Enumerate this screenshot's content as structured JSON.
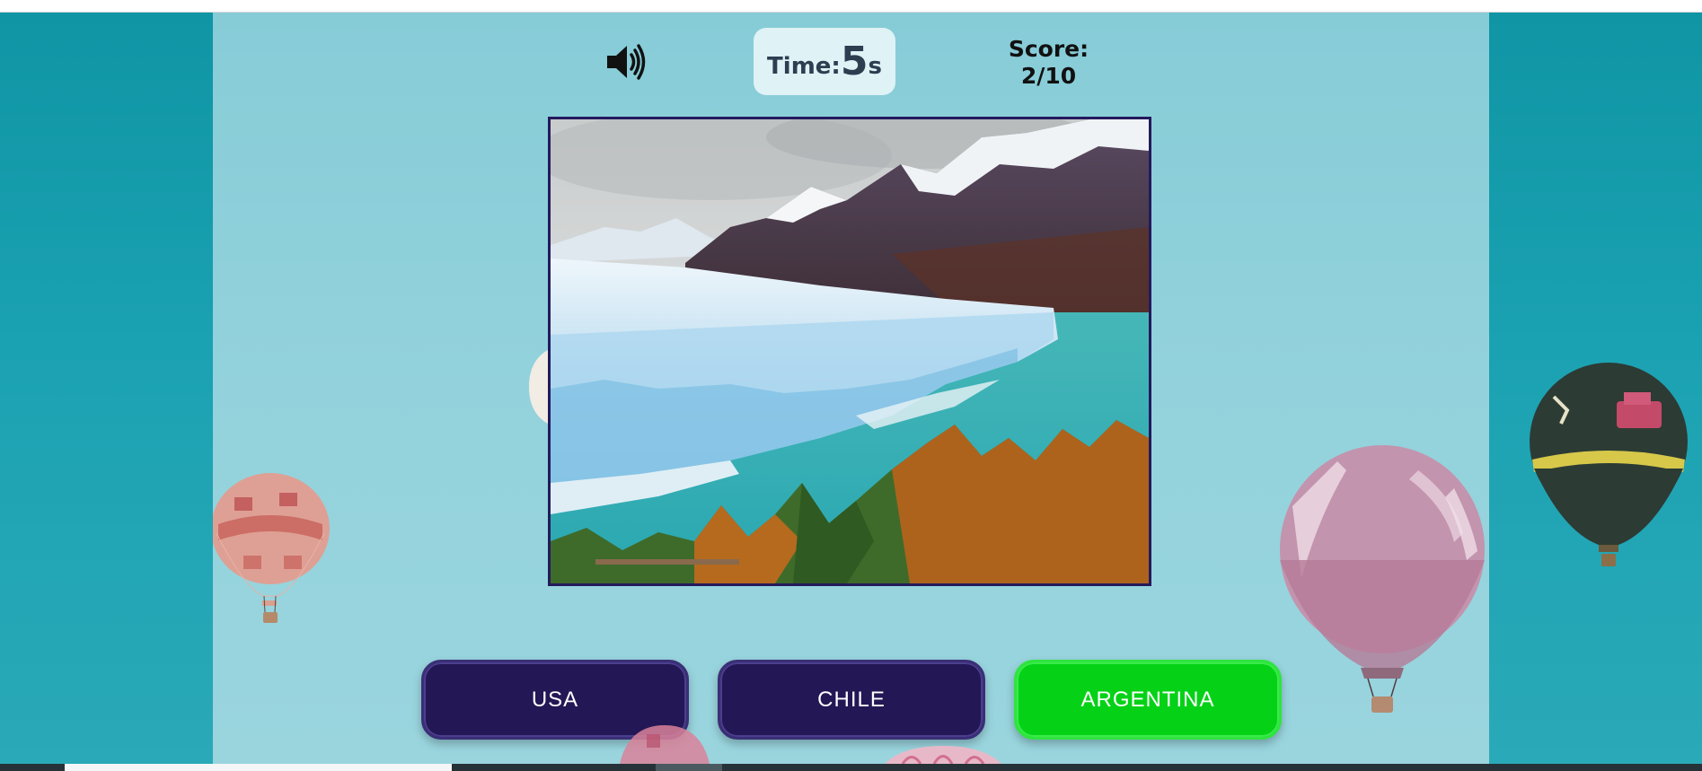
{
  "header": {
    "sound_icon": "speaker-volume-icon",
    "timer_label": "Time:",
    "timer_value": "5",
    "timer_unit": "s",
    "score_label": "Score:",
    "score_value": "2/10"
  },
  "answers": [
    {
      "label": "USA",
      "state": "default",
      "color": "#241755"
    },
    {
      "label": "CHILE",
      "state": "default",
      "color": "#241755"
    },
    {
      "label": "ARGENTINA",
      "state": "correct",
      "color": "#05d217"
    }
  ],
  "colors": {
    "outer_background": "#1499a8",
    "panel_background": "#93d2dc",
    "photo_border": "#231a5c",
    "timer_background": "#dff2f5"
  }
}
